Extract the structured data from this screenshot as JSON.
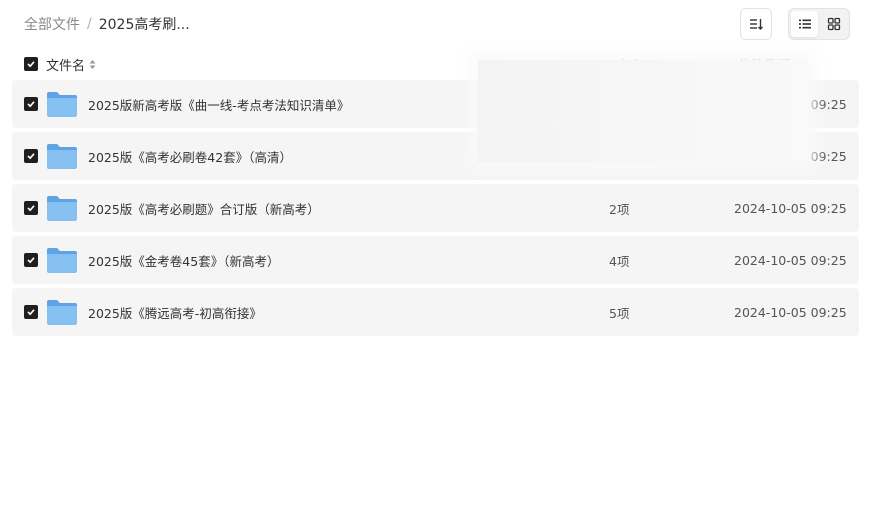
{
  "breadcrumb": {
    "root": "全部文件",
    "separator": "/",
    "current": "2025高考刷..."
  },
  "toolbar": {
    "sort_icon": "sort-descending-icon",
    "view_list_icon": "list-view-icon",
    "view_grid_icon": "grid-view-icon",
    "active_view": "list"
  },
  "table": {
    "header": {
      "name": "文件名",
      "size": "大小",
      "date": "修改日期"
    },
    "rows": [
      {
        "name": "2025版新高考版《曲一线-考点考法知识清单》",
        "size": "",
        "date": "2024-10-05 09:25",
        "checked": true
      },
      {
        "name": "2025版《高考必刷卷42套》（高清）",
        "size": "",
        "date": "2024-10-05 09:25",
        "checked": true
      },
      {
        "name": "2025版《高考必刷题》合订版（新高考）",
        "size": "2项",
        "date": "2024-10-05 09:25",
        "checked": true
      },
      {
        "name": "2025版《金考卷45套》（新高考）",
        "size": "4项",
        "date": "2024-10-05 09:25",
        "checked": true
      },
      {
        "name": "2025版《腾远高考-初高衔接》",
        "size": "5项",
        "date": "2024-10-05 09:25",
        "checked": true
      }
    ]
  },
  "colors": {
    "folder": "#78b6ee",
    "row_bg": "#f5f5f5",
    "checkbox": "#1f1f1f"
  }
}
